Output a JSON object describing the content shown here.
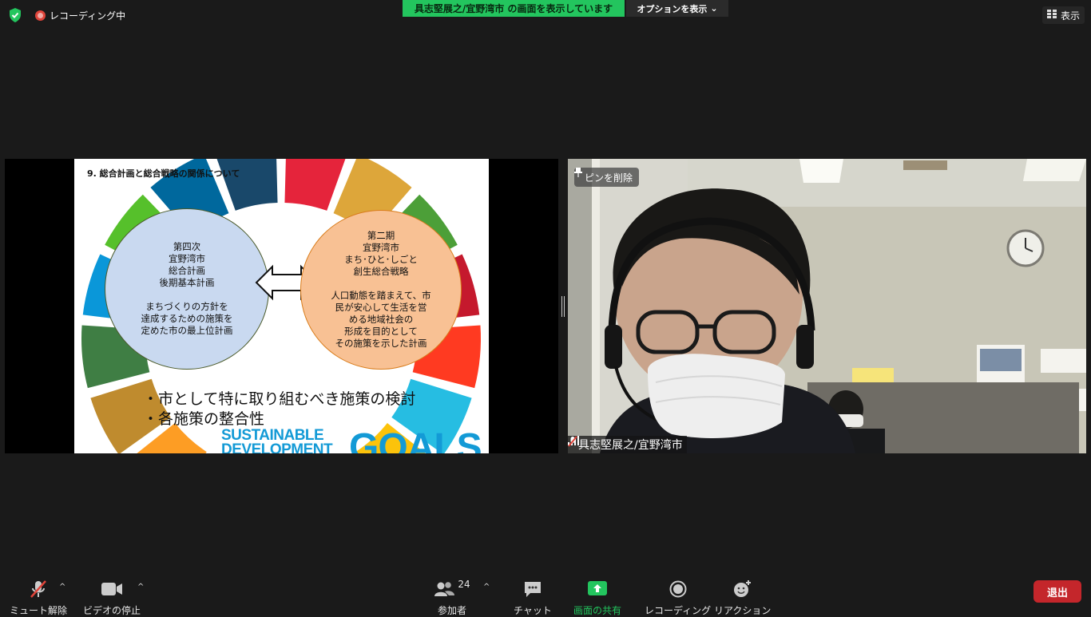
{
  "topbar": {
    "recording_label": "レコーディング中",
    "share_banner": "具志堅展之/宜野湾市 の画面を表示しています",
    "options_label": "オプションを表示",
    "view_label": "表示"
  },
  "slide": {
    "title": "9. 総合計画と総合戦略の関係について",
    "left_circle": [
      "第四次",
      "宜野湾市",
      "総合計画",
      "後期基本計画",
      "",
      "まちづくりの方針を",
      "達成するための施策を",
      "定めた市の最上位計画"
    ],
    "right_circle": [
      "第二期",
      "宜野湾市",
      "まち･ひと･しごと",
      "創生総合戦略",
      "",
      "人口動態を踏まえて、市",
      "民が安心して生活を営",
      "める地域社会の",
      "形成を目的として",
      "その施策を示した計画"
    ],
    "bullets": [
      "・市として特に取り組むべき施策の検討",
      "・各施策の整合性"
    ],
    "logo_line1": "SUSTAINABLE",
    "logo_line2": "DEVELOPMENT",
    "logo_goals": "GOALS",
    "sdg_colors": [
      "#e5243b",
      "#dda63a",
      "#4c9f38",
      "#c5192d",
      "#ff3a21",
      "#26bde2",
      "#fcc30b",
      "#a21942",
      "#fd6925",
      "#dd1367",
      "#fd9d24",
      "#bf8b2e",
      "#3f7e44",
      "#0a97d9",
      "#56c02b",
      "#00689d",
      "#19486a"
    ]
  },
  "video": {
    "pin_label": "ピンを削除",
    "participant_name": "具志堅展之/宜野湾市"
  },
  "toolbar": {
    "mute_label": "ミュート解除",
    "video_label": "ビデオの停止",
    "participants_label": "参加者",
    "participants_count": "24",
    "chat_label": "チャット",
    "share_label": "画面の共有",
    "record_label": "レコーディング",
    "reaction_label": "リアクション",
    "leave_label": "退出"
  }
}
